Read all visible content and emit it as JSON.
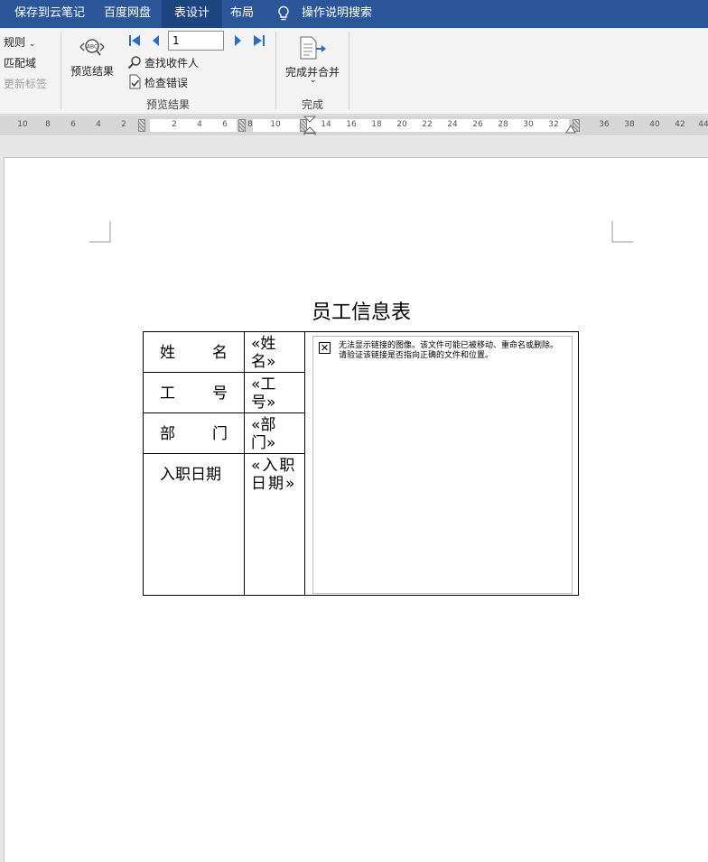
{
  "tabs": [
    {
      "label": "保存到云笔记",
      "active": false
    },
    {
      "label": "百度网盘",
      "active": false
    },
    {
      "label": "表设计",
      "active": true
    },
    {
      "label": "布局",
      "active": false
    }
  ],
  "tell_me": "操作说明搜索",
  "ribbon": {
    "rules": "规则",
    "match_fields": "匹配域",
    "update_labels": "更新标签",
    "preview_results": "预览结果",
    "record_number": "1",
    "find_recipient": "查找收件人",
    "check_errors": "检查错误",
    "preview_group": "预览结果",
    "finish_merge": "完成并合并",
    "finish_group": "完成"
  },
  "ruler": {
    "left_numbers": [
      "10",
      "8",
      "6",
      "4",
      "2"
    ],
    "mid_numbers": [
      "2",
      "4",
      "6"
    ],
    "right_numbers": [
      "8",
      "10",
      "14",
      "16",
      "18",
      "20",
      "22",
      "24",
      "26",
      "28",
      "30",
      "32",
      "36",
      "38",
      "40",
      "42",
      "44"
    ]
  },
  "document": {
    "title": "员工信息表",
    "rows": [
      {
        "label": [
          "姓",
          "名"
        ],
        "field": "«姓名»"
      },
      {
        "label": [
          "工",
          "号"
        ],
        "field": "«工号»"
      },
      {
        "label": [
          "部",
          "门"
        ],
        "field": "«部门»"
      },
      {
        "label": [
          "入职日期"
        ],
        "field": "«入职日期»"
      }
    ],
    "broken_image_message": "无法显示链接的图像。该文件可能已被移动、重命名或删除。请验证该链接是否指向正确的文件和位置。"
  }
}
